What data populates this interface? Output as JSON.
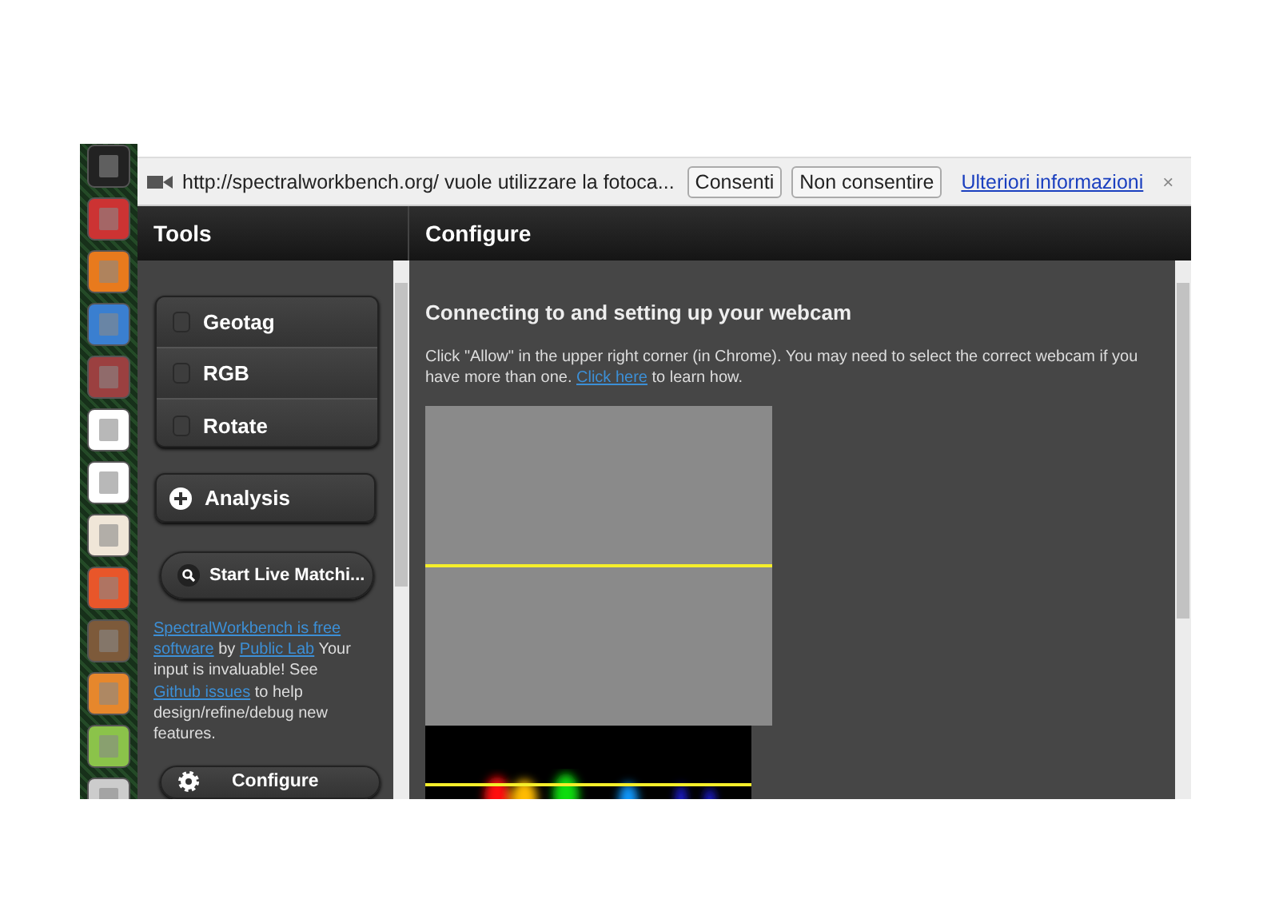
{
  "infobar": {
    "message": "http://spectralworkbench.org/ vuole utilizzare la fotoca...",
    "buttons": [
      "Consenti",
      "Non consentire"
    ],
    "link": "Ulteriori informazioni",
    "close": "×"
  },
  "sidebar": {
    "title": "Tools",
    "options": [
      {
        "label": "Geotag",
        "checked": false
      },
      {
        "label": "RGB",
        "checked": false
      },
      {
        "label": "Rotate",
        "checked": false
      }
    ],
    "analysis": {
      "label": "Analysis",
      "expanded": false
    },
    "live_button": "Start Live Matchi...",
    "about": [
      {
        "text": "SpectralWorkbench is free",
        "link": true
      },
      {
        "text": "software",
        "link": true
      },
      {
        "text": " by ",
        "link": false
      },
      {
        "text": "Public Lab",
        "link": true
      },
      {
        "text": " Your input is invaluable! See ",
        "link": false
      },
      {
        "text": "Github issues",
        "link": true
      },
      {
        "text": " to help design/refine/debug new features.",
        "link": false
      }
    ],
    "configure_button": "Configure"
  },
  "main": {
    "title": "Configure",
    "heading": "Connecting to and setting up your webcam",
    "instructions": [
      {
        "text": "Click \"Allow\" in the upper right corner (in Chrome). You may need to select the correct webcam if you have more than one. ",
        "link": false
      },
      {
        "text": "Click here",
        "link": true
      },
      {
        "text": " to learn how.",
        "link": false
      }
    ]
  }
}
